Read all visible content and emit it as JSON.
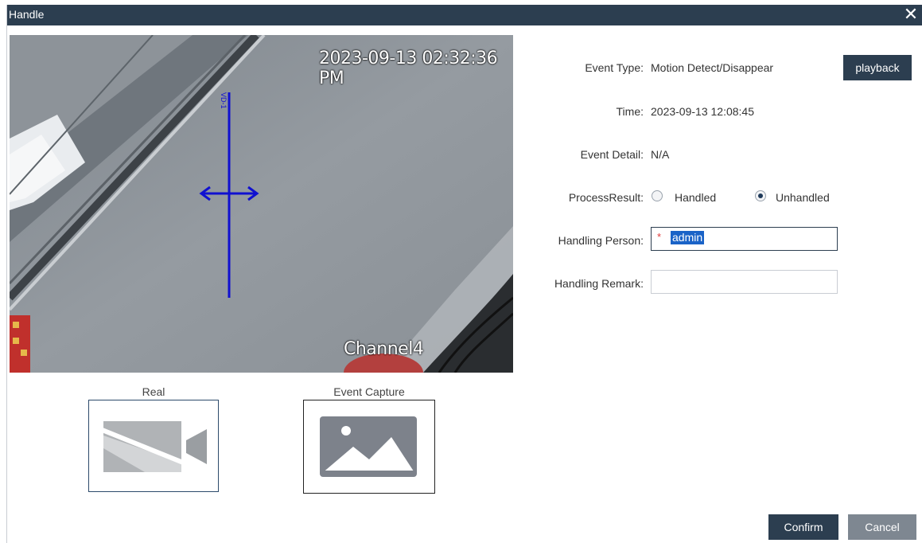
{
  "window": {
    "title": "Handle",
    "close_glyph": "✕"
  },
  "video": {
    "timestamp": "2023-09-13 02:32:36 PM",
    "channel": "Channel4",
    "overlay_label": "VD-1"
  },
  "thumbnails": {
    "real_label": "Real",
    "real_icon": "video-off-icon",
    "capture_label": "Event Capture",
    "capture_icon": "image-icon"
  },
  "form": {
    "event_type_label": "Event Type:",
    "event_type_value": "Motion Detect/Disappear",
    "playback_label": "playback",
    "time_label": "Time:",
    "time_value": "2023-09-13 12:08:45",
    "event_detail_label": "Event Detail:",
    "event_detail_value": "N/A",
    "process_result_label": "ProcessResult:",
    "options": [
      {
        "label": "Handled",
        "selected": false
      },
      {
        "label": "Unhandled",
        "selected": true
      }
    ],
    "handling_person_label": "Handling Person:",
    "handling_person_required": "*",
    "handling_person_value": "admin",
    "handling_remark_label": "Handling Remark:",
    "handling_remark_value": ""
  },
  "footer": {
    "confirm_label": "Confirm",
    "cancel_label": "Cancel"
  },
  "colors": {
    "titlebar": "#2c3e50",
    "button_primary": "#2c3e50",
    "button_secondary": "#7e8791",
    "overlay_line": "#1010d0",
    "selection": "#1a63c7"
  }
}
